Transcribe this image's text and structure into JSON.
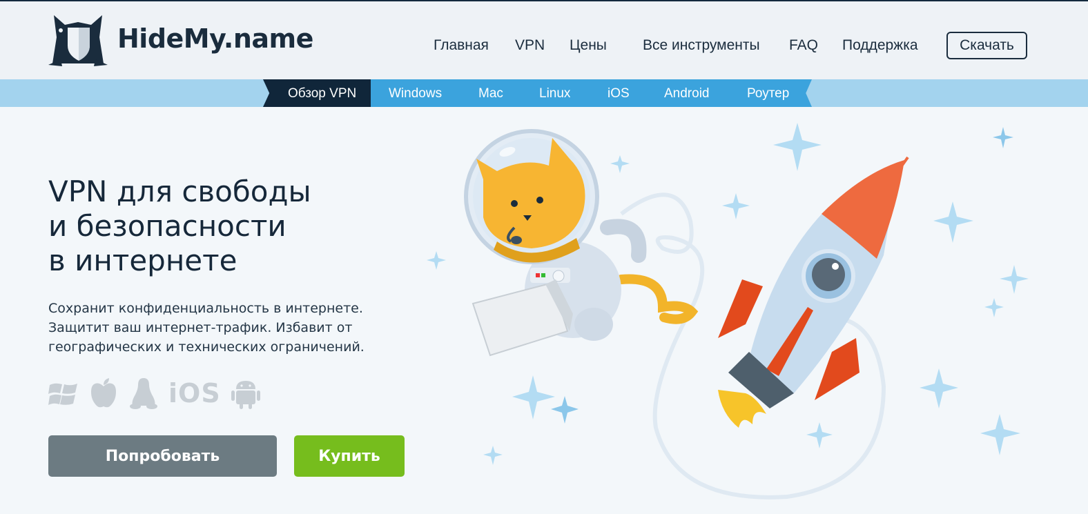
{
  "header": {
    "brand": "HideMy.name",
    "nav": [
      "Главная",
      "VPN",
      "Цены",
      "Все инструменты",
      "FAQ",
      "Поддержка"
    ],
    "download_label": "Скачать"
  },
  "subnav": {
    "active": "Обзор VPN",
    "items": [
      "Windows",
      "Mac",
      "Linux",
      "iOS",
      "Android",
      "Роутер"
    ]
  },
  "hero": {
    "title_lines": [
      "VPN для свободы",
      "и безопасности",
      "в интернете"
    ],
    "description_lines": [
      "Сохранит конфиденциальность в интернете.",
      "Защитит ваш интернет-трафик. Избавит от",
      "географических и технических ограничений."
    ],
    "platforms": [
      "windows-icon",
      "apple-icon",
      "linux-icon",
      "iOS",
      "android-icon"
    ],
    "try_label": "Попробовать",
    "buy_label": "Купить"
  },
  "colors": {
    "header_bg": "#eef2f6",
    "subnav_bg": "#a3d3ee",
    "subnav_strip": "#3ba3dd",
    "subnav_active": "#10263a",
    "try_button": "#6c7b82",
    "buy_button": "#76bd1d"
  }
}
